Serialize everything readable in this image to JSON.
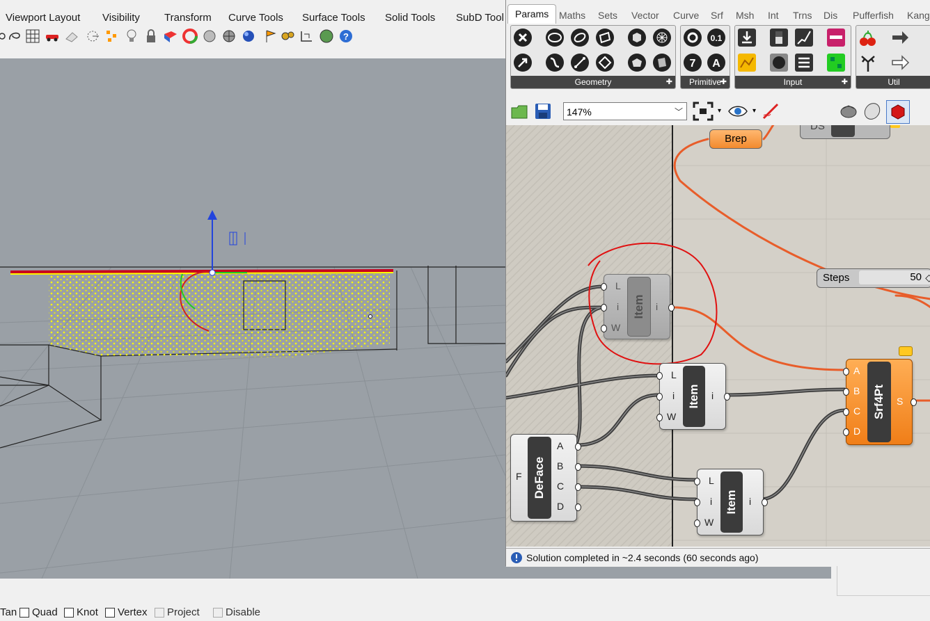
{
  "rhino": {
    "menu": [
      "Viewport Layout",
      "Visibility",
      "Transform",
      "Curve Tools",
      "Surface Tools",
      "Solid Tools",
      "SubD Tool"
    ],
    "osnaps": [
      {
        "label": "Tan",
        "checked": false,
        "enabled": true
      },
      {
        "label": "Quad",
        "checked": false,
        "enabled": true
      },
      {
        "label": "Knot",
        "checked": false,
        "enabled": true
      },
      {
        "label": "Vertex",
        "checked": false,
        "enabled": true
      },
      {
        "label": "Project",
        "checked": false,
        "enabled": false
      },
      {
        "label": "Disable",
        "checked": false,
        "enabled": false
      }
    ],
    "toolbar_icons": [
      "lasso-icon",
      "grid-icon",
      "car-icon",
      "eraser-icon",
      "snap-icon",
      "points-icon",
      "light-bulb-icon",
      "lock-icon",
      "material-icon",
      "color-wheel-icon",
      "sphere-icon",
      "sphere-shaded-icon",
      "sphere-blue-icon",
      "flag-icon",
      "gears-icon",
      "dimension-icon",
      "globe-icon",
      "help-icon"
    ]
  },
  "gh": {
    "tabs": [
      "Params",
      "Maths",
      "Sets",
      "Vector",
      "Curve",
      "Srf",
      "Msh",
      "Int",
      "Trns",
      "Dis",
      "Pufferfish",
      "Kange"
    ],
    "active_tab": "Params",
    "panels": {
      "geometry": "Geometry",
      "primitive": "Primitive",
      "input": "Input",
      "util": "Util"
    },
    "zoom": "147%",
    "canvas": {
      "brep_label": "Brep",
      "ds_label": "DS",
      "steps": {
        "label": "Steps",
        "value": "50"
      },
      "item_title": "Item",
      "item_inputs": [
        "L",
        "i",
        "W"
      ],
      "item_output": "i",
      "deface": {
        "title": "DeFace",
        "input": "F",
        "outputs": [
          "A",
          "B",
          "C",
          "D"
        ]
      },
      "srf4pt": {
        "title": "Srf4Pt",
        "inputs": [
          "A",
          "B",
          "C",
          "D"
        ],
        "output": "S"
      }
    },
    "status": "Solution completed in ~2.4 seconds (60 seconds ago)"
  }
}
